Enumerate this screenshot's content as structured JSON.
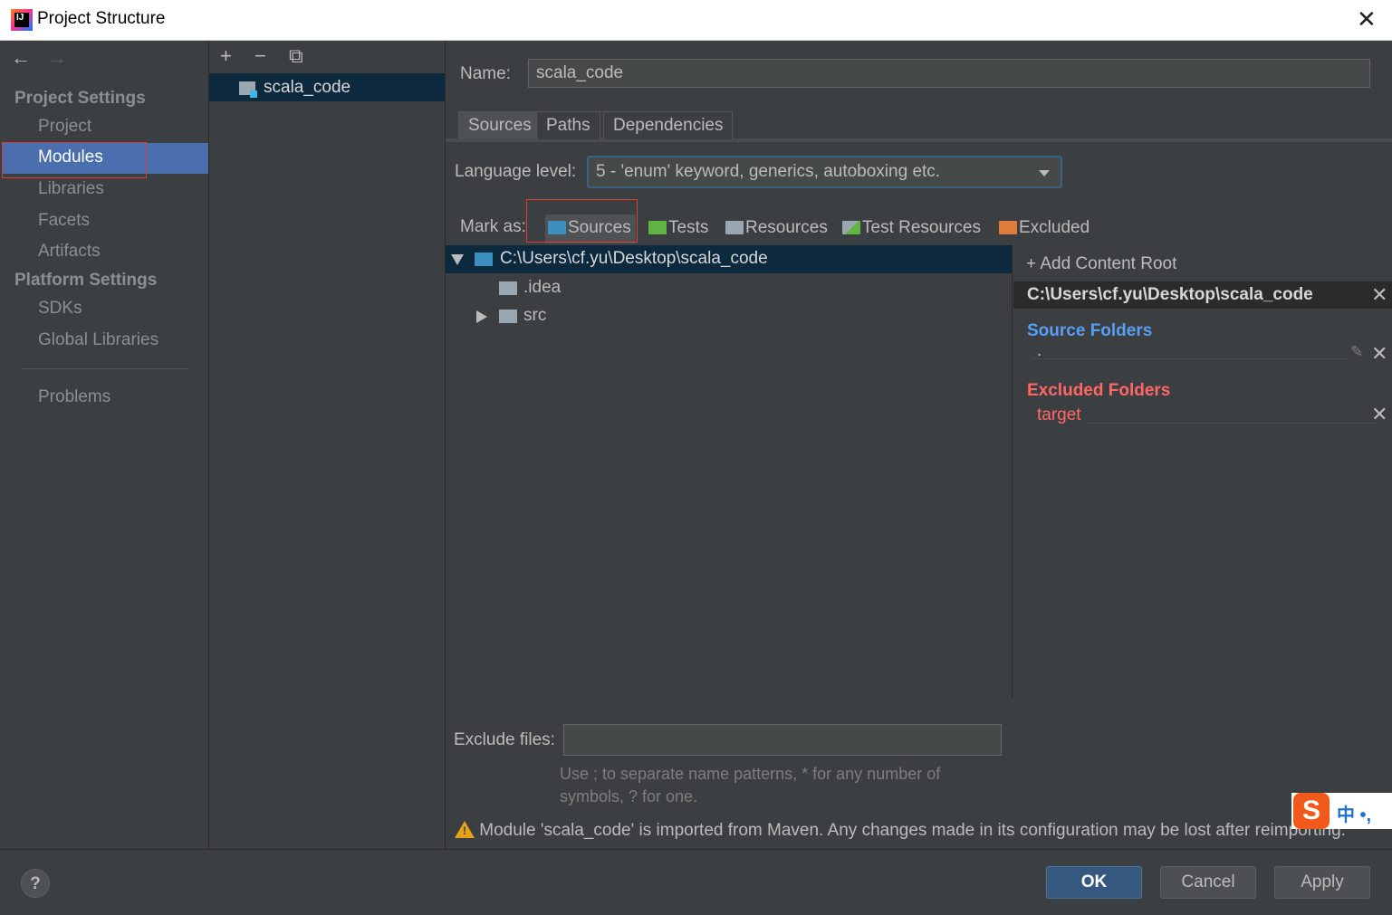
{
  "window": {
    "title": "Project Structure",
    "close_glyph": "✕"
  },
  "nav": {
    "back": "←",
    "forward": "→",
    "project_settings": "Project Settings",
    "items_project": [
      "Project",
      "Modules",
      "Libraries",
      "Facets",
      "Artifacts"
    ],
    "platform_settings": "Platform Settings",
    "items_platform": [
      "SDKs",
      "Global Libraries"
    ],
    "problems": "Problems",
    "selected": "Modules"
  },
  "modules": {
    "toolbar": {
      "add": "+",
      "remove": "−",
      "copy": "⧉"
    },
    "list": [
      "scala_code"
    ]
  },
  "detail": {
    "name_label": "Name:",
    "name_value": "scala_code",
    "tabs": [
      "Sources",
      "Paths",
      "Dependencies"
    ],
    "active_tab": "Sources",
    "language_label": "Language level:",
    "language_value": "5 - 'enum' keyword, generics, autoboxing etc.",
    "mark_as_label": "Mark as:",
    "mark_buttons": [
      "Sources",
      "Tests",
      "Resources",
      "Test Resources",
      "Excluded"
    ],
    "tree": {
      "root": "C:\\Users\\cf.yu\\Desktop\\scala_code",
      "children": [
        ".idea",
        "src"
      ]
    },
    "content_root": {
      "add_label": "+ Add Content Root",
      "path": "C:\\Users\\cf.yu\\Desktop\\scala_code",
      "source_header": "Source Folders",
      "source_item": ".",
      "excluded_header": "Excluded Folders",
      "excluded_item": "target"
    },
    "exclude_files_label": "Exclude files:",
    "exclude_files_value": "",
    "hint": "Use ; to separate name patterns, * for any number of symbols, ? for one.",
    "warning": "Module 'scala_code' is imported from Maven. Any changes made in its configuration may be lost after reimporting."
  },
  "buttons": {
    "help": "?",
    "ok": "OK",
    "cancel": "Cancel",
    "apply": "Apply"
  },
  "ime": {
    "logo": "S",
    "text": "中 •,"
  },
  "colors": {
    "accent": "#4b6eaf",
    "selection": "#0d293e",
    "source_blue": "#589df6",
    "excluded_red": "#ff6666",
    "tests_green": "#62b543",
    "excluded_orange": "#e07b39"
  }
}
